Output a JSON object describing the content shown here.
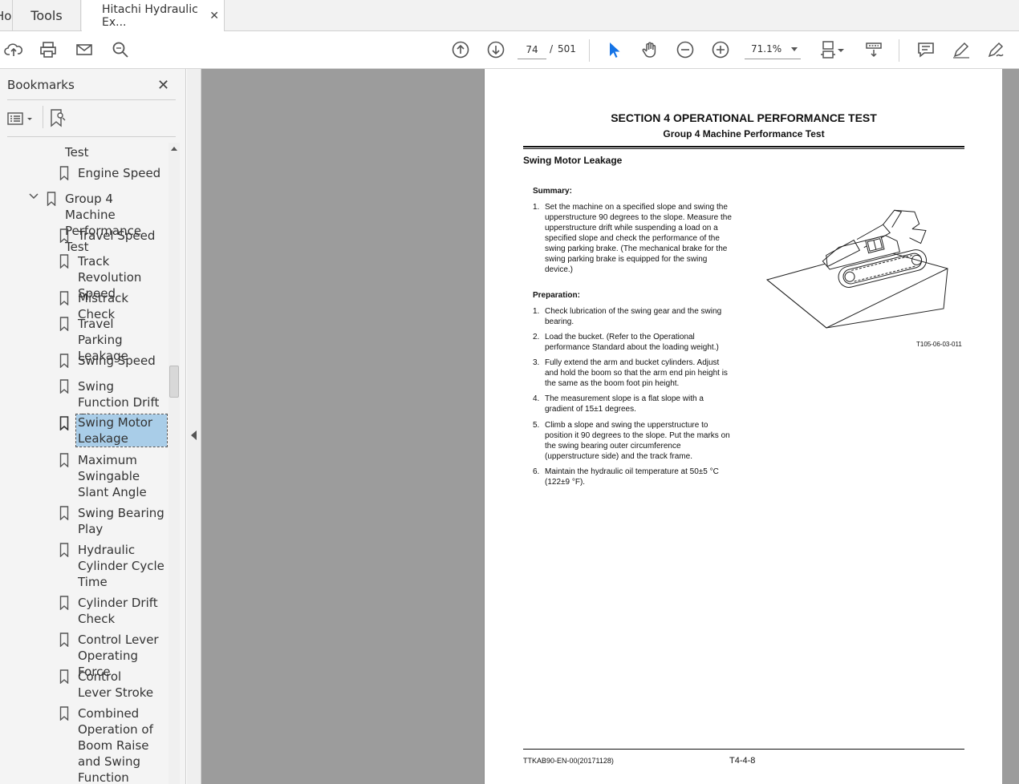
{
  "tabs": {
    "home_label": "Home",
    "tools_label": "Tools",
    "doc_label": "Hitachi Hydraulic Ex...",
    "close_glyph": "✕"
  },
  "toolbar": {
    "current_page": "74",
    "page_separator": "/",
    "total_pages": "501",
    "zoom": "71.1%"
  },
  "sidebar": {
    "title": "Bookmarks",
    "close_glyph": "✕",
    "items": [
      {
        "label": "Test"
      },
      {
        "label": "Engine Speed"
      },
      {
        "label": "Group 4 Machine Performance Test"
      },
      {
        "label": "Travel Speed"
      },
      {
        "label": "Track Revolution Speed"
      },
      {
        "label": "Mistrack Check"
      },
      {
        "label": "Travel Parking Leakage"
      },
      {
        "label": "Swing Speed"
      },
      {
        "label": "Swing Function Drift Check"
      },
      {
        "label": "Swing Motor Leakage"
      },
      {
        "label": "Maximum Swingable Slant Angle"
      },
      {
        "label": "Swing Bearing Play"
      },
      {
        "label": "Hydraulic Cylinder Cycle Time"
      },
      {
        "label": "Cylinder Drift Check"
      },
      {
        "label": "Control Lever Operating Force"
      },
      {
        "label": "Control Lever Stroke"
      },
      {
        "label": "Combined Operation of Boom Raise and Swing Function Check"
      }
    ]
  },
  "page": {
    "section_title": "SECTION 4 OPERATIONAL PERFORMANCE TEST",
    "group_title": "Group 4 Machine Performance Test",
    "heading": "Swing Motor Leakage",
    "summary_label": "Summary:",
    "summary_items": [
      {
        "num": "1.",
        "text": "Set the machine on a specified slope and swing the upperstructure 90 degrees to the slope. Measure the upperstructure drift while suspending a load on a specified slope and check the performance of the swing parking brake. (The mechanical brake for the swing parking brake is equipped for the swing device.)"
      }
    ],
    "preparation_label": "Preparation:",
    "preparation_items": [
      {
        "num": "1.",
        "text": "Check lubrication of the swing gear and the swing bearing."
      },
      {
        "num": "2.",
        "text": "Load the bucket. (Refer to the Operational performance Standard about the loading weight.)"
      },
      {
        "num": "3.",
        "text": "Fully extend the arm and bucket cylinders. Adjust and hold the boom so that the arm end pin height is the same as the boom foot pin height."
      },
      {
        "num": "4.",
        "text": "The measurement slope is a flat slope with a gradient of 15±1 degrees."
      },
      {
        "num": "5.",
        "text": "Climb a slope and swing the upperstructure to position it 90 degrees to the slope. Put the marks on the swing bearing outer circumference (upperstructure side) and the track frame."
      },
      {
        "num": "6.",
        "text": "Maintain the hydraulic oil temperature at 50±5 °C (122±9 °F)."
      }
    ],
    "figure_caption": "T105-06-03-011",
    "footer_left": "TTKAB90-EN-00(20171128)",
    "footer_page": "T4-4-8"
  }
}
